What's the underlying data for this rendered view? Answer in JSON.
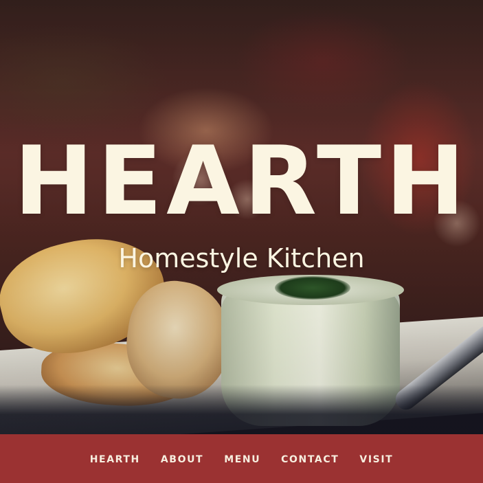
{
  "hero": {
    "brand": "HEARTH",
    "tagline": "Homestyle Kitchen"
  },
  "nav": {
    "items": [
      {
        "label": "HEARTH"
      },
      {
        "label": "ABOUT"
      },
      {
        "label": "MENU"
      },
      {
        "label": "CONTACT"
      },
      {
        "label": "VISIT"
      }
    ]
  },
  "colors": {
    "nav_background": "#9b3232",
    "text_cream": "#fbf5e2"
  }
}
